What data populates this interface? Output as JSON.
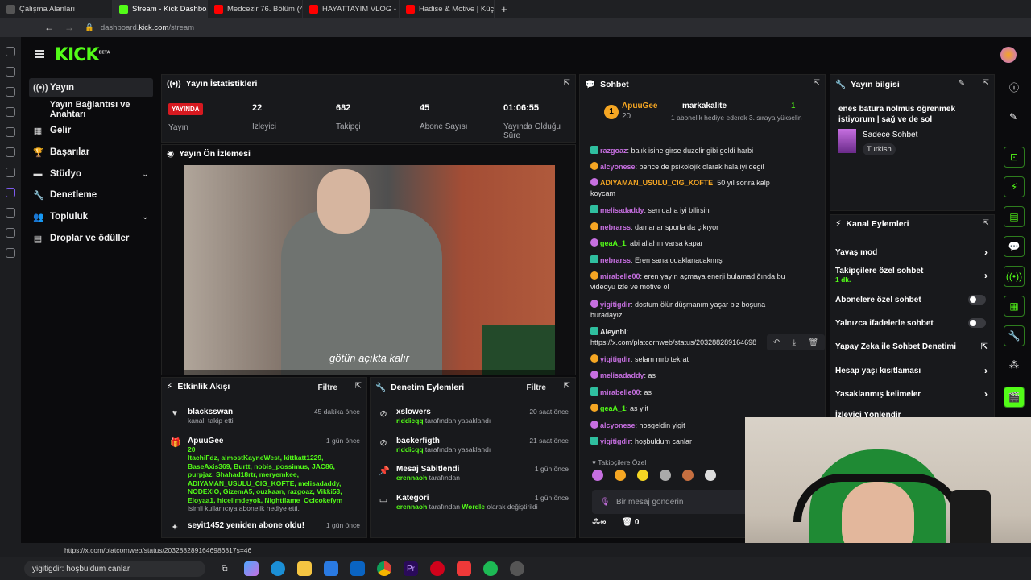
{
  "browser": {
    "tabs": [
      {
        "label": "Çalışma Alanları",
        "color": "#666"
      },
      {
        "label": "Stream - Kick Dashboard",
        "color": "#53fc18"
      },
      {
        "label": "Medcezir 76. Bölüm (4K) - Y",
        "color": "#ff0000"
      },
      {
        "label": "HAYATTAYIM VLOG - YouTu",
        "color": "#ff0000"
      },
      {
        "label": "Hadise & Motive | Küçük B",
        "color": "#ff0000"
      }
    ],
    "url_prefix": "dashboard.",
    "url_host": "kick.com",
    "url_path": "/stream"
  },
  "nav": {
    "items": [
      {
        "label": "Yayın",
        "icon": "broadcast-icon"
      },
      {
        "label": "Yayın Bağlantısı ve Anahtarı",
        "icon": ""
      },
      {
        "label": "Gelir",
        "icon": "revenue-icon"
      },
      {
        "label": "Başarılar",
        "icon": "trophy-icon"
      },
      {
        "label": "Stüdyo",
        "icon": "studio-icon"
      },
      {
        "label": "Denetleme",
        "icon": "wrench-icon"
      },
      {
        "label": "Topluluk",
        "icon": "community-icon"
      },
      {
        "label": "Droplar ve ödüller",
        "icon": "drops-icon"
      }
    ]
  },
  "stats": {
    "title": "Yayın İstatistikleri",
    "live_badge": "YAYINDA",
    "live_label": "Yayın",
    "viewers": "22",
    "viewers_label": "İzleyici",
    "followers": "682",
    "followers_label": "Takipçi",
    "subs": "45",
    "subs_label": "Abone Sayısı",
    "uptime": "01:06:55",
    "uptime_label": "Yayında Olduğu Süre"
  },
  "preview": {
    "title": "Yayın Ön İzlemesi",
    "caption": "götün açıkta kalır"
  },
  "activity": {
    "title": "Etkinlik Akışı",
    "filter": "Filtre",
    "items": [
      {
        "name": "blacksswan",
        "sub": "kanalı takip etti",
        "time": "45 dakika önce"
      },
      {
        "name": "ApuuGee",
        "count": "20",
        "gifted": "ItachiFdz, almostKayneWest, kittkatt1229, BaseAxis369, Burtt, nobis_possimus, JAC86, purpjaz, Shahad18rtr, meryemkee, ADIYAMAN_USULU_CIG_KOFTE, melisadaddy, NODEXIO, GizemA5, ouzkaan, razgoaz, Vikki53, Eloyaa1, hicelimdeyok, Nightflame_Ocicokefym",
        "sub": "isimli kullanıcıya abonelik hediye etti.",
        "time": "1 gün önce"
      },
      {
        "name": "seyit1452 yeniden abone oldu!",
        "time": "1 gün önce"
      }
    ]
  },
  "moderation": {
    "title": "Denetim Eylemleri",
    "filter": "Filtre",
    "items": [
      {
        "name": "xslowers",
        "by": "riddicqq",
        "sub": "tarafından yasaklandı",
        "time": "20 saat önce"
      },
      {
        "name": "backerfigth",
        "by": "riddicqq",
        "sub": "tarafından yasaklandı",
        "time": "21 saat önce"
      },
      {
        "name": "Mesaj Sabitlendi",
        "by": "erennaoh",
        "sub": "tarafından",
        "time": "1 gün önce"
      },
      {
        "name": "Kategori",
        "by": "erennaoh",
        "sub": "tarafından",
        "target": "Wordle",
        "sub2": "olarak değiştirildi",
        "time": "1 gün önce"
      }
    ]
  },
  "chat": {
    "title": "Sohbet",
    "pinned_user": "ApuuGee",
    "pinned_count": "20",
    "pinned_target": "markakalite",
    "pinned_num": "1",
    "pinned_text": "1 abonelik hediye ederek 3. sıraya yükselin",
    "placeholder": "Bir mesaj gönderin",
    "followers_only": "Takipçilere Özel",
    "footer_count": "0",
    "messages": [
      {
        "u": "razgoaz",
        "c": "#c66fe0",
        "t": "balık isine girse duzelir gibi geldi harbi"
      },
      {
        "u": "alcyonese",
        "c": "#c66fe0",
        "t": "bence de psikolojik olarak hala iyi degil"
      },
      {
        "u": "ADIYAMAN_USULU_CIG_KOFTE",
        "c": "#f5a623",
        "t": "50 yıl sonra kalp koycam"
      },
      {
        "u": "melisadaddy",
        "c": "#c66fe0",
        "t": "sen daha iyi bilirsin"
      },
      {
        "u": "nebrarss",
        "c": "#c66fe0",
        "t": "damarlar sporla da çıkıyor"
      },
      {
        "u": "geaA_1",
        "c": "#53fc18",
        "t": "abi allahın varsa kapar"
      },
      {
        "u": "nebrarss",
        "c": "#c66fe0",
        "t": "Eren sana odaklanacakmış"
      },
      {
        "u": "mirabelle00",
        "c": "#c66fe0",
        "t": "eren yayın açmaya enerji bulamadığında bu videoyu izle ve motive ol"
      },
      {
        "u": "yigitigdir",
        "c": "#c66fe0",
        "t": "dostum ölür düşmanım yaşar biz boşuna buradayız"
      },
      {
        "u": "Aleynbl",
        "c": "#e6e6e6",
        "t": "https://x.com/platcornweb/status/203288289164698"
      },
      {
        "u": "yigitigdir",
        "c": "#c66fe0",
        "t": "selam mrb tekrat"
      },
      {
        "u": "melisadaddy",
        "c": "#c66fe0",
        "t": "as"
      },
      {
        "u": "mirabelle00",
        "c": "#c66fe0",
        "t": "as"
      },
      {
        "u": "geaA_1",
        "c": "#53fc18",
        "t": "as yiit"
      },
      {
        "u": "alcyonese",
        "c": "#c66fe0",
        "t": "hosgeldin yigit"
      },
      {
        "u": "yigitigdir",
        "c": "#c66fe0",
        "t": "hoşbuldum canlar"
      }
    ]
  },
  "info": {
    "title": "Yayın bilgisi",
    "stream_title": "enes batura nolmus öğrenmek istiyorum | sağ ve de sol",
    "category": "Sadece Sohbet",
    "language": "Turkish"
  },
  "actions": {
    "title": "Kanal Eylemleri",
    "items": [
      {
        "label": "Yavaş mod",
        "type": "chevron"
      },
      {
        "label": "Takipçilere özel sohbet",
        "extra": "1 dk.",
        "type": "chevron"
      },
      {
        "label": "Abonelere özel sohbet",
        "type": "toggle"
      },
      {
        "label": "Yalnızca ifadelerle sohbet",
        "type": "toggle"
      },
      {
        "label": "Yapay Zeka ile Sohbet Denetimi",
        "type": "external"
      },
      {
        "label": "Hesap yaşı kısıtlaması",
        "type": "chevron"
      },
      {
        "label": "Yasaklanmış kelimeler",
        "type": "chevron"
      },
      {
        "label": "İzleyici Yönlendir",
        "type": "none"
      }
    ]
  },
  "status_url": "https://x.com/platcornweb/status/2032882891646986817s=46",
  "taskbar": {
    "search_text": "yigitigdir: hoşbuldum canlar"
  }
}
